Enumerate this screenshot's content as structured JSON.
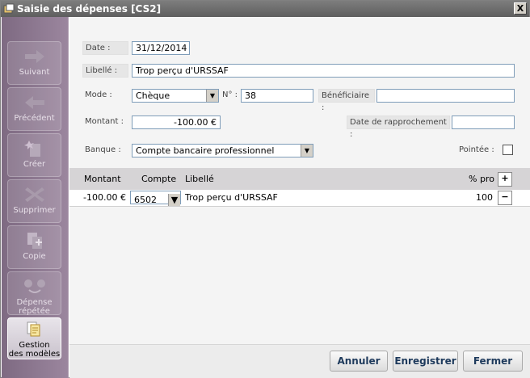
{
  "window": {
    "title": "Saisie des dépenses [CS2]",
    "close": "X"
  },
  "sidebar": {
    "items": [
      {
        "label": "Suivant",
        "icon": "arrow-right-icon"
      },
      {
        "label": "Précédent",
        "icon": "arrow-left-icon"
      },
      {
        "label": "Créer",
        "icon": "new-doc-icon"
      },
      {
        "label": "Supprimer",
        "icon": "delete-x-icon"
      },
      {
        "label": "Copie",
        "icon": "copy-doc-icon"
      },
      {
        "label1": "Dépense",
        "label2": "répétée",
        "icon": "repeat-expense-icon"
      },
      {
        "label1": "Gestion",
        "label2": "des modèles",
        "icon": "templates-icon"
      }
    ]
  },
  "form": {
    "date_label": "Date :",
    "date_value": "31/12/2014",
    "libelle_label": "Libellé :",
    "libelle_value": "Trop perçu d'URSSAF",
    "mode_label": "Mode :",
    "mode_value": "Chèque",
    "num_label": "N° :",
    "num_value": "38",
    "beneficiaire_label": "Bénéficiaire :",
    "beneficiaire_value": "",
    "montant_label": "Montant :",
    "montant_value": "-100.00 €",
    "rapprochement_label": "Date de rapprochement :",
    "rapprochement_value": "",
    "banque_label": "Banque :",
    "banque_value": "Compte bancaire professionnel",
    "pointee_label": "Pointée :",
    "pointee_checked": false
  },
  "grid": {
    "headers": {
      "montant": "Montant",
      "compte": "Compte",
      "libelle": "Libellé",
      "pro": "% pro"
    },
    "rows": [
      {
        "montant": "-100.00 €",
        "compte": "6502",
        "libelle": "Trop perçu d'URSSAF",
        "pro": "100"
      }
    ],
    "add": "+",
    "remove": "−"
  },
  "footer": {
    "annuler": "Annuler",
    "enregistrer": "Enregistrer",
    "fermer": "Fermer"
  }
}
